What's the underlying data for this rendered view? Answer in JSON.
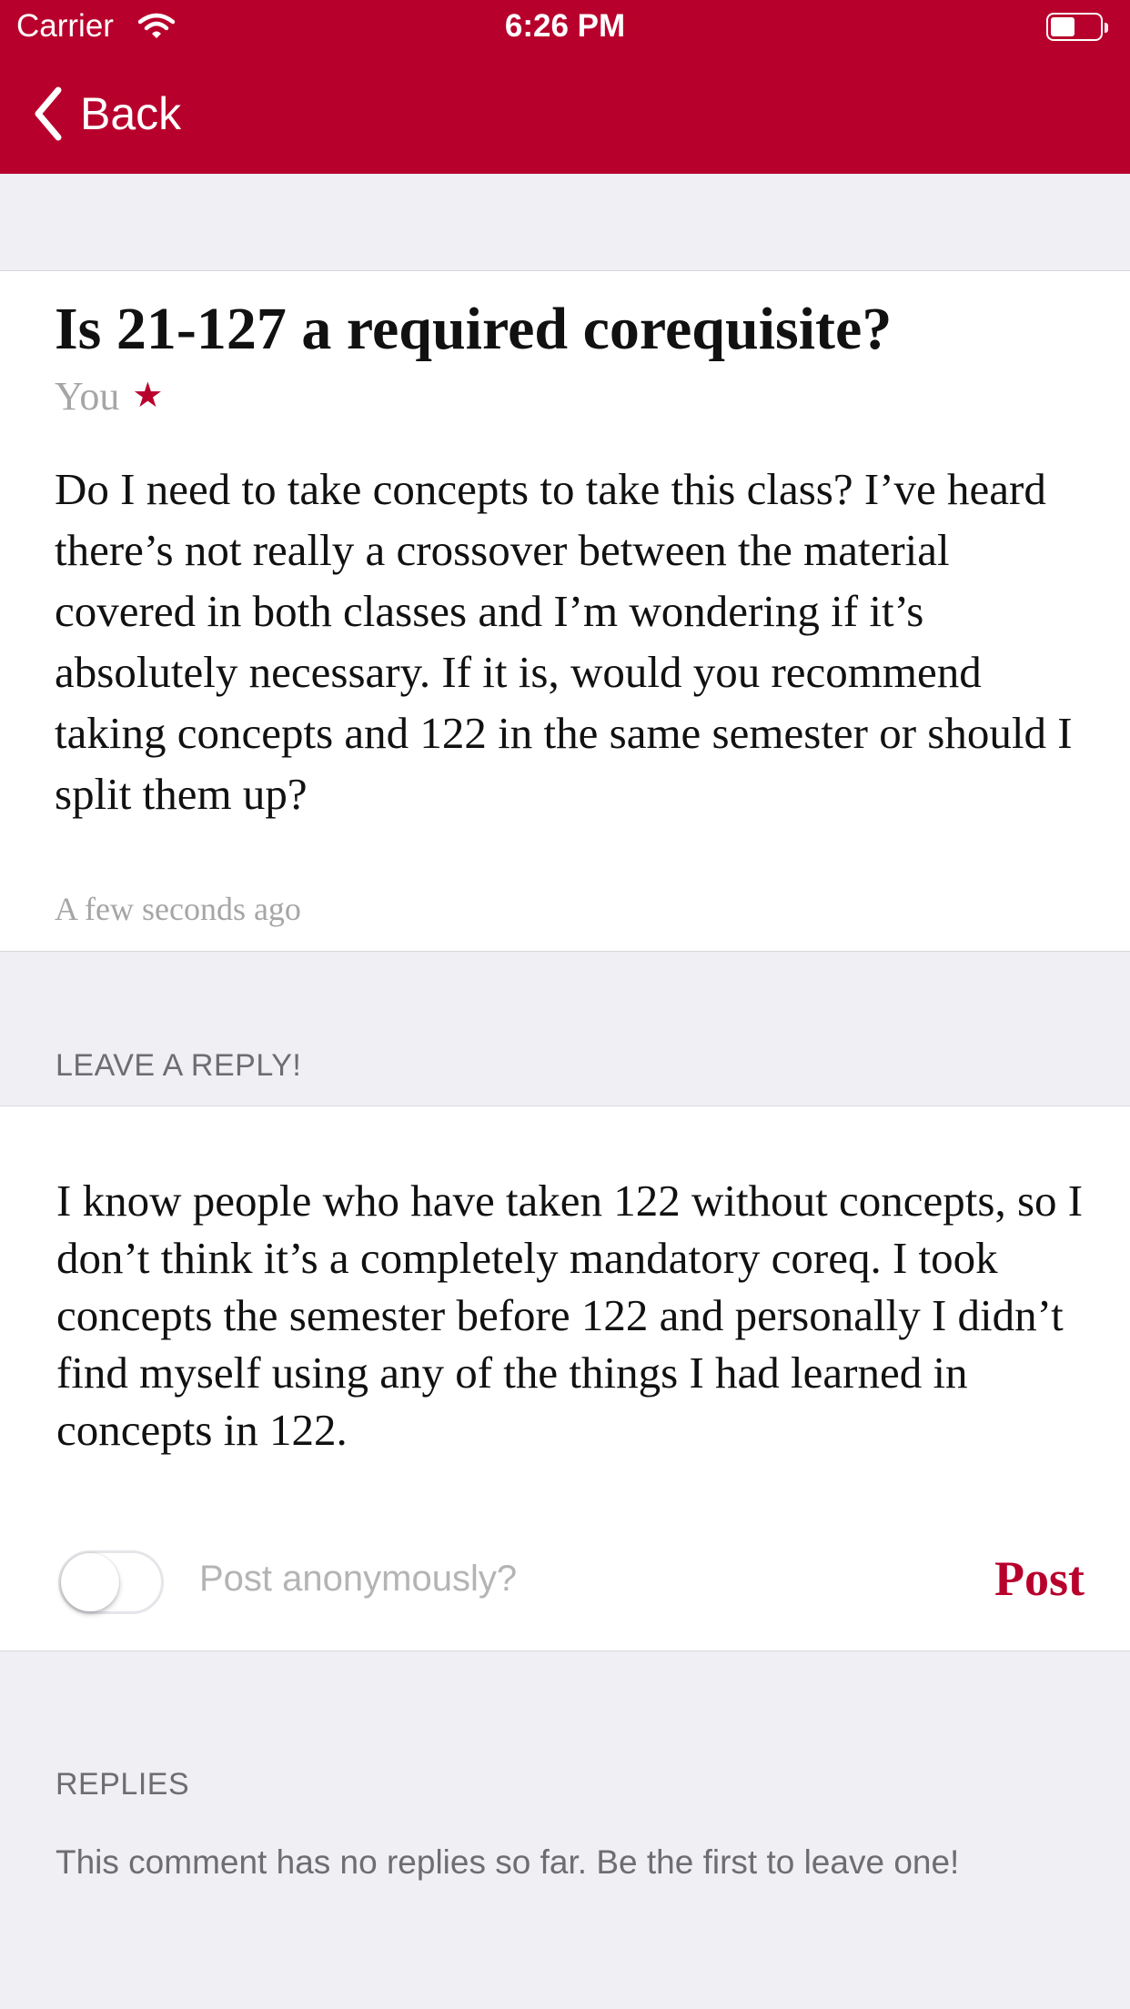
{
  "status_bar": {
    "carrier": "Carrier",
    "time": "6:26 PM",
    "battery_level": 0.55
  },
  "nav": {
    "back_label": "Back"
  },
  "question": {
    "title": "Is 21-127 a required corequisite?",
    "author": "You",
    "body": "Do I need to take concepts to take this class? I’ve heard there’s not really a crossover between the material covered in both classes and I’m wondering if it’s absolutely necessary. If it is, would you recommend taking concepts and 122 in the same semester or should I split them up?",
    "timestamp": "A few seconds ago"
  },
  "reply_section": {
    "header": "LEAVE A REPLY!",
    "text_value": "I know people who have taken 122 without concepts, so I don’t think it’s a completely mandatory coreq.  I took concepts the semester before 122 and personally I didn’t find myself using any of the things I had learned in concepts in 122.",
    "anonymous_label": "Post anonymously?",
    "anonymous_on": false,
    "post_label": "Post"
  },
  "replies": {
    "header": "REPLIES",
    "empty_message": "This comment has no replies so far.  Be the first to leave one!"
  },
  "colors": {
    "accent": "#b8002c",
    "background": "#efeff4",
    "secondary_text": "#a6a6a6"
  }
}
